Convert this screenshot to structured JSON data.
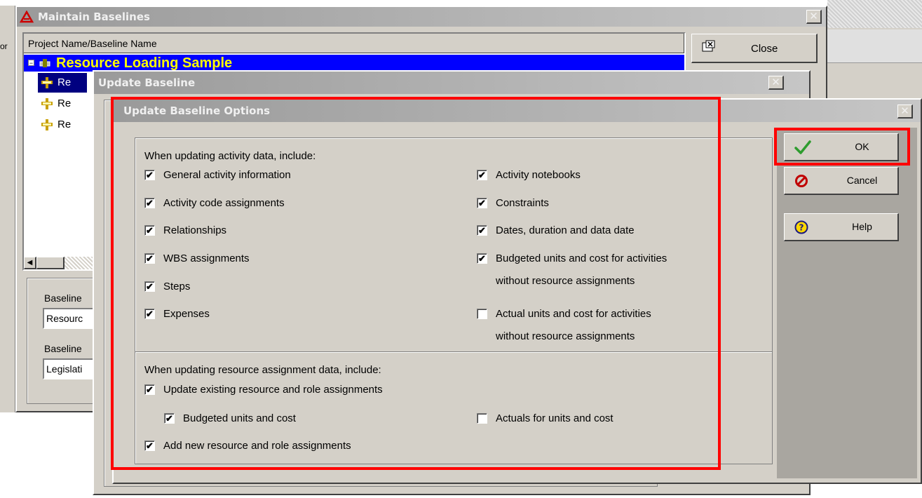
{
  "maintain": {
    "title": "Maintain Baselines",
    "close_glyph": "✕",
    "column_header": "Project Name/Baseline Name",
    "project_name": "Resource Loading Sample",
    "rows": [
      "Re",
      "Re",
      "Re"
    ],
    "close_label": "Close",
    "baseline_label_1": "Baseline",
    "baseline_value_1": "Resourc",
    "baseline_label_2": "Baseline",
    "baseline_value_2": "Legislati",
    "edge_text": "or"
  },
  "update_baseline": {
    "title": "Update Baseline",
    "close_glyph": "✕"
  },
  "options": {
    "title": "Update Baseline Options",
    "close_glyph": "✕",
    "activity_heading": "When updating activity data, include:",
    "activity_left": [
      {
        "label": "General activity information",
        "checked": true
      },
      {
        "label": "Activity code assignments",
        "checked": true
      },
      {
        "label": "Relationships",
        "checked": true
      },
      {
        "label": "WBS assignments",
        "checked": true
      },
      {
        "label": "Steps",
        "checked": true
      },
      {
        "label": "Expenses",
        "checked": true
      }
    ],
    "activity_right": [
      {
        "label": "Activity notebooks",
        "checked": true
      },
      {
        "label": "Constraints",
        "checked": true
      },
      {
        "label": "Dates, duration and data date",
        "checked": true
      },
      {
        "label": "Budgeted units and cost for activities",
        "label2": "without resource assignments",
        "checked": true
      },
      {
        "label": "Actual units and cost for activities",
        "label2": "without resource assignments",
        "checked": false
      }
    ],
    "resource_heading": "When updating resource assignment data, include:",
    "update_existing": "Update existing resource and role assignments",
    "budgeted_units": "Budgeted units and cost",
    "actuals_units": "Actuals for units and cost",
    "add_new": "Add new resource and role assignments",
    "ok_label": "OK",
    "cancel_label": "Cancel",
    "help_label": "Help",
    "checkmark": "✔"
  },
  "colors": {
    "dialog_gray": "#d4d0c8",
    "selection_blue": "#0000ff",
    "project_text": "#ffff00",
    "highlight_red": "#ff0000",
    "ok_green": "#2e9c2e"
  }
}
